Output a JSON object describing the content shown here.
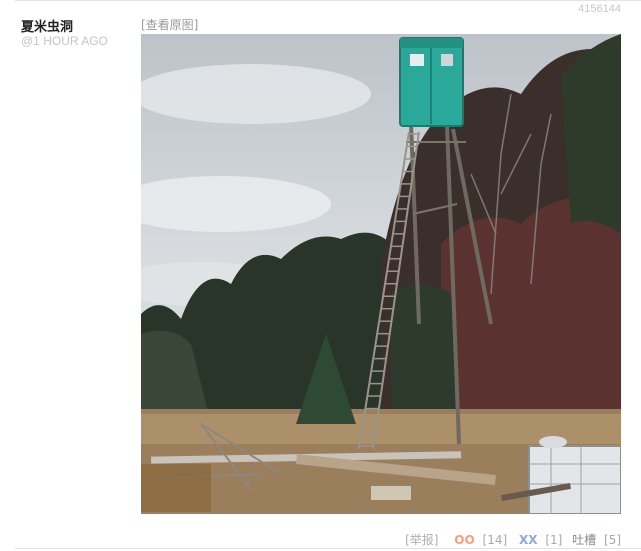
{
  "post": {
    "id": "4156144",
    "author": "夏米虫洞",
    "time": "@1 HOUR AGO",
    "view_original": "[查看原图]"
  },
  "actions": {
    "report": "[举报]",
    "oo_label": "OO",
    "oo_count": "[14]",
    "xx_label": "XX",
    "xx_count": "[1]",
    "tucao_label": "吐槽",
    "tucao_count": "[5]"
  },
  "colors": {
    "oo": "#f5a07a",
    "xx": "#8aa9e0",
    "tower_cabin": "#2aa99a"
  }
}
